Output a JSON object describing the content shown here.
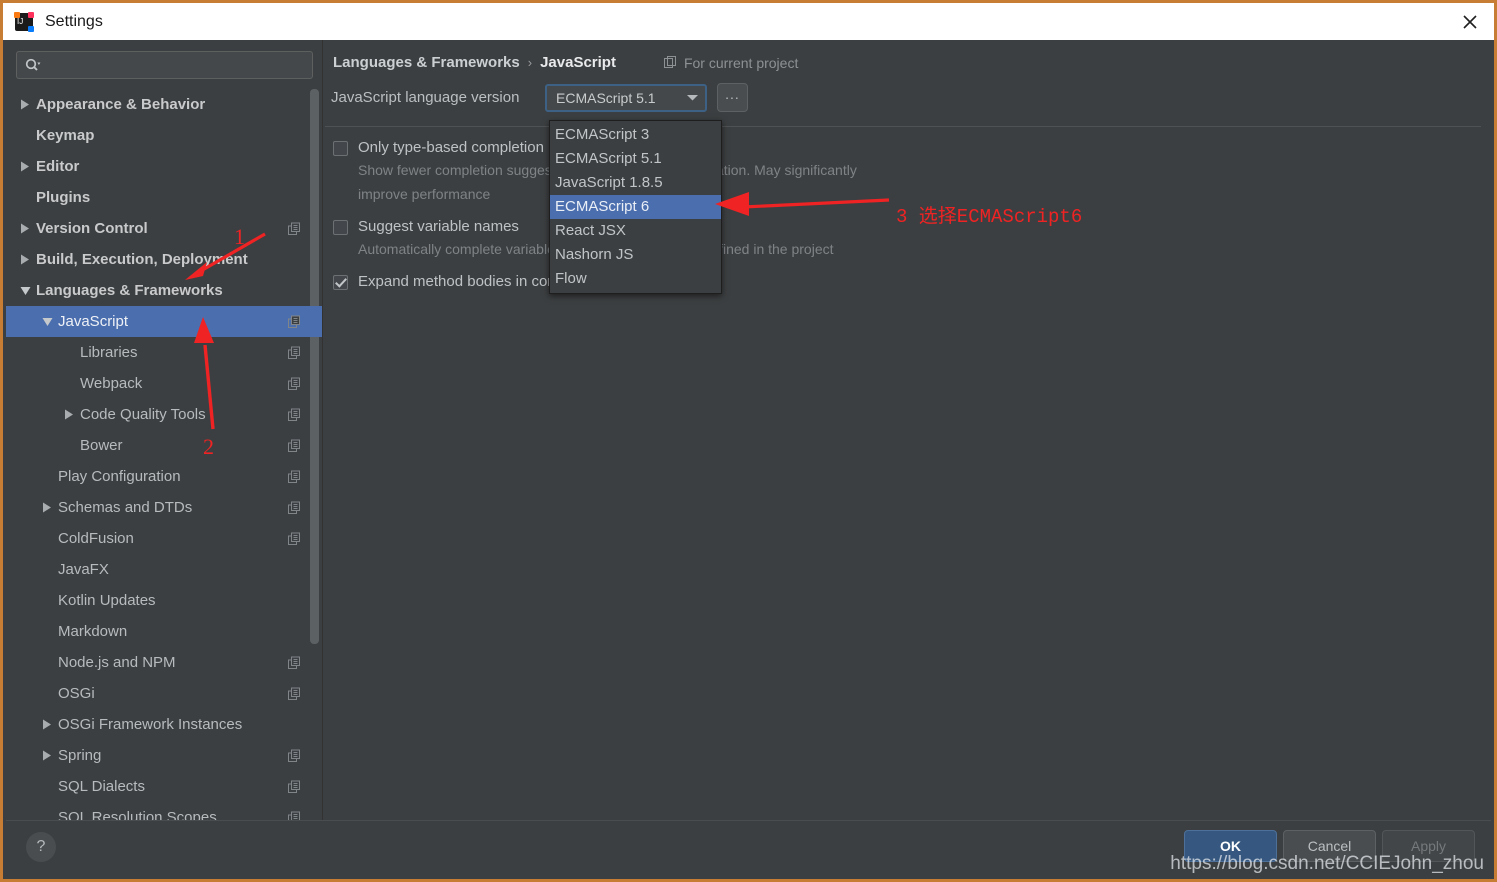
{
  "window": {
    "title": "Settings",
    "app_icon": "intellij-idea-icon",
    "close_icon": "close-icon",
    "frame_color": "#c87d35"
  },
  "sidebar": {
    "search": {
      "placeholder": "",
      "value": "",
      "icon": "search-icon"
    },
    "items": [
      {
        "label": "Appearance & Behavior",
        "twisty": "collapsed",
        "level": 0,
        "top": true,
        "icon": false,
        "selected": false
      },
      {
        "label": "Keymap",
        "twisty": "none",
        "level": 0,
        "top": true,
        "icon": false,
        "selected": false
      },
      {
        "label": "Editor",
        "twisty": "collapsed",
        "level": 0,
        "top": true,
        "icon": false,
        "selected": false
      },
      {
        "label": "Plugins",
        "twisty": "none",
        "level": 0,
        "top": true,
        "icon": false,
        "selected": false
      },
      {
        "label": "Version Control",
        "twisty": "collapsed",
        "level": 0,
        "top": true,
        "icon": true,
        "selected": false
      },
      {
        "label": "Build, Execution, Deployment",
        "twisty": "collapsed",
        "level": 0,
        "top": true,
        "icon": false,
        "selected": false
      },
      {
        "label": "Languages & Frameworks",
        "twisty": "expanded",
        "level": 0,
        "top": true,
        "icon": false,
        "selected": false
      },
      {
        "label": "JavaScript",
        "twisty": "expanded",
        "level": 1,
        "top": false,
        "icon": true,
        "selected": true
      },
      {
        "label": "Libraries",
        "twisty": "none",
        "level": 2,
        "top": false,
        "icon": true,
        "selected": false
      },
      {
        "label": "Webpack",
        "twisty": "none",
        "level": 2,
        "top": false,
        "icon": true,
        "selected": false
      },
      {
        "label": "Code Quality Tools",
        "twisty": "collapsed",
        "level": 2,
        "top": false,
        "icon": true,
        "selected": false
      },
      {
        "label": "Bower",
        "twisty": "none",
        "level": 2,
        "top": false,
        "icon": true,
        "selected": false
      },
      {
        "label": "Play Configuration",
        "twisty": "none",
        "level": 1,
        "top": false,
        "icon": true,
        "selected": false
      },
      {
        "label": "Schemas and DTDs",
        "twisty": "collapsed",
        "level": 1,
        "top": false,
        "icon": true,
        "selected": false
      },
      {
        "label": "ColdFusion",
        "twisty": "none",
        "level": 1,
        "top": false,
        "icon": true,
        "selected": false
      },
      {
        "label": "JavaFX",
        "twisty": "none",
        "level": 1,
        "top": false,
        "icon": false,
        "selected": false
      },
      {
        "label": "Kotlin Updates",
        "twisty": "none",
        "level": 1,
        "top": false,
        "icon": false,
        "selected": false
      },
      {
        "label": "Markdown",
        "twisty": "none",
        "level": 1,
        "top": false,
        "icon": false,
        "selected": false
      },
      {
        "label": "Node.js and NPM",
        "twisty": "none",
        "level": 1,
        "top": false,
        "icon": true,
        "selected": false
      },
      {
        "label": "OSGi",
        "twisty": "none",
        "level": 1,
        "top": false,
        "icon": true,
        "selected": false
      },
      {
        "label": "OSGi Framework Instances",
        "twisty": "collapsed",
        "level": 1,
        "top": false,
        "icon": false,
        "selected": false
      },
      {
        "label": "Spring",
        "twisty": "collapsed",
        "level": 1,
        "top": false,
        "icon": true,
        "selected": false
      },
      {
        "label": "SQL Dialects",
        "twisty": "none",
        "level": 1,
        "top": false,
        "icon": true,
        "selected": false
      },
      {
        "label": "SQL Resolution Scopes",
        "twisty": "none",
        "level": 1,
        "top": false,
        "icon": true,
        "selected": false
      }
    ]
  },
  "content": {
    "breadcrumb": {
      "parent": "Languages & Frameworks",
      "separator": "›",
      "current": "JavaScript",
      "note": "For current project",
      "note_icon": "project-scope-icon"
    },
    "language_version": {
      "label": "JavaScript language version",
      "value": "ECMAScript 5.1",
      "arrow_icon": "chevron-down-icon",
      "browse_label": "...",
      "options": [
        "ECMAScript 3",
        "ECMAScript 5.1",
        "JavaScript 1.8.5",
        "ECMAScript 6",
        "React JSX",
        "Nashorn JS",
        "Flow"
      ],
      "highlighted_option": "ECMAScript 6"
    },
    "options": [
      {
        "label": "Only type-based completion",
        "checked": false,
        "description": "Show fewer completion suggestions based on type information. May significantly improve performance"
      },
      {
        "label": "Suggest variable names",
        "checked": false,
        "description": "Automatically complete variable names based on types defined in the project"
      },
      {
        "label": "Expand method bodies in completion for overrides",
        "checked": true,
        "description": ""
      }
    ]
  },
  "footer": {
    "help_label": "?",
    "ok_label": "OK",
    "cancel_label": "Cancel",
    "apply_label": "Apply"
  },
  "annotations": {
    "marker_1": "1",
    "marker_2": "2",
    "step_3_text": "3 选择ECMAScript6",
    "color": "#ef2323"
  },
  "watermark": "https://blog.csdn.net/CCIEJohn_zhou"
}
